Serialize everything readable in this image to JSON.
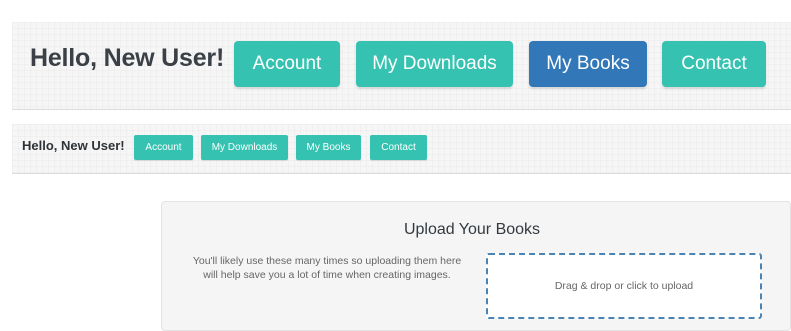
{
  "header_large": {
    "greeting": "Hello, New User!",
    "nav": [
      {
        "label": "Account",
        "active": false
      },
      {
        "label": "My Downloads",
        "active": false
      },
      {
        "label": "My Books",
        "active": true
      },
      {
        "label": "Contact",
        "active": false
      }
    ]
  },
  "header_small": {
    "greeting": "Hello, New User!",
    "nav": [
      {
        "label": "Account"
      },
      {
        "label": "My Downloads"
      },
      {
        "label": "My Books"
      },
      {
        "label": "Contact"
      }
    ]
  },
  "upload": {
    "title": "Upload Your Books",
    "description": "You'll likely use these many times so uploading them here will help save you a lot of time when creating images.",
    "dropzone_label": "Drag & drop or click to upload"
  },
  "colors": {
    "nav_default": "#35c2b0",
    "nav_active": "#3278b8",
    "dropzone_border": "#4a84b4"
  }
}
